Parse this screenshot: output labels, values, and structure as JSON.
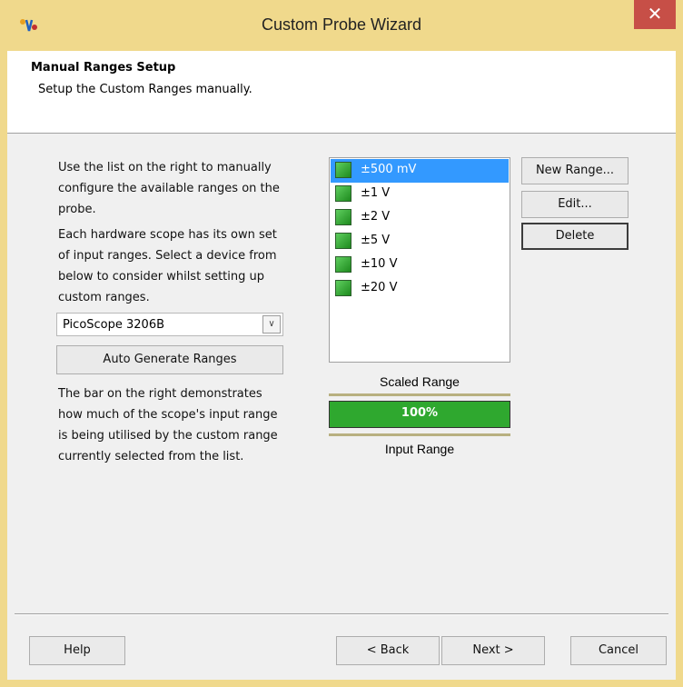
{
  "window": {
    "title": "Custom Probe Wizard",
    "close_glyph": "✕",
    "icon": "picoscope-app-icon"
  },
  "header": {
    "title": "Manual Ranges Setup",
    "subtitle": "Setup the Custom Ranges manually."
  },
  "left": {
    "para1": [
      "Use the list on the right to manually",
      "configure the available ranges on the",
      "probe."
    ],
    "para2": [
      "Each hardware scope has its own set",
      "of input ranges. Select a device from",
      "below to consider whilst setting up",
      "custom ranges."
    ],
    "device_select": {
      "value": "PicoScope 3206B"
    },
    "auto_generate_label": "Auto Generate Ranges",
    "para3": [
      "The bar on the right demonstrates",
      "how much of the scope's input range",
      "is being utilised by the custom range",
      "currently selected from the list."
    ]
  },
  "ranges": {
    "items": [
      {
        "label": "±500 mV",
        "selected": true
      },
      {
        "label": "±1 V",
        "selected": false
      },
      {
        "label": "±2 V",
        "selected": false
      },
      {
        "label": "±5 V",
        "selected": false
      },
      {
        "label": "±10 V",
        "selected": false
      },
      {
        "label": "±20 V",
        "selected": false
      }
    ]
  },
  "buttons": {
    "new_range": "New Range...",
    "edit": "Edit...",
    "delete": "Delete"
  },
  "utilisation": {
    "scaled_label": "Scaled Range",
    "input_label": "Input Range",
    "percent_text": "100%",
    "fill_fraction": 1.0
  },
  "footer": {
    "help": "Help",
    "back": "< Back",
    "next": "Next >",
    "cancel": "Cancel"
  },
  "colors": {
    "title_bar": "#f0d98c",
    "close": "#c74f47",
    "selection": "#3399ff",
    "bar_fill": "#2fa82f"
  }
}
